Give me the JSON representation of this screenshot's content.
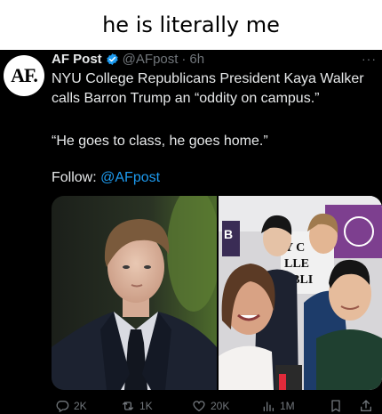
{
  "caption": "he is literally me",
  "tweet": {
    "avatar_text": "AF.",
    "author_name": "AF Post",
    "handle": "@AFpost",
    "separator": "·",
    "time": "6h",
    "more": "···",
    "body": "NYU College Republicans President Kaya Walker calls Barron Trump an “oddity on campus.”",
    "quote": "“He goes to class, he goes home.”",
    "follow_label": "Follow:",
    "follow_handle": "@AFpost",
    "signs": {
      "sign_b": "B",
      "sign_yc": "Y C",
      "sign_lle": "LLE",
      "sign_ubli": "UBLI"
    },
    "actions": {
      "replies": "2K",
      "reposts": "1K",
      "likes": "20K",
      "views": "1M"
    }
  },
  "colors": {
    "link": "#1d9bf0",
    "muted": "#71767b",
    "text": "#e7e9ea",
    "background": "#000000"
  },
  "icons": [
    "verified-badge-icon",
    "more-icon",
    "reply-icon",
    "repost-icon",
    "like-icon",
    "views-icon",
    "bookmark-icon",
    "share-icon"
  ]
}
